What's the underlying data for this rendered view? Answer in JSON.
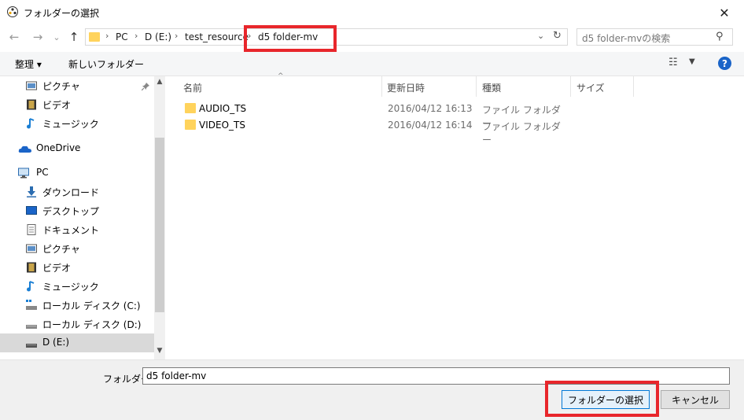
{
  "window": {
    "title": "フォルダーの選択",
    "close_glyph": "✕"
  },
  "nav": {
    "back_glyph": "←",
    "forward_glyph": "→",
    "recent_glyph": "⌄",
    "up_glyph": "↑",
    "breadcrumbs": [
      "PC",
      "D (E:)",
      "test_resource",
      "d5 folder-mv"
    ],
    "sep_glyph": "›",
    "chevron_glyph": "⌄",
    "refresh_glyph": "↻",
    "search_placeholder": "d5 folder-mvの検索",
    "search_glyph": "⚲"
  },
  "toolbar": {
    "organize_label": "整理 ▾",
    "new_folder_label": "新しいフォルダー",
    "view_glyph": "☷",
    "view_chevron": "▼",
    "help_glyph": "?"
  },
  "sidebar": {
    "items": [
      {
        "label": "ピクチャ"
      },
      {
        "label": "ビデオ"
      },
      {
        "label": "ミュージック"
      },
      {
        "label": "OneDrive"
      },
      {
        "label": "PC"
      },
      {
        "label": "ダウンロード"
      },
      {
        "label": "デスクトップ"
      },
      {
        "label": "ドキュメント"
      },
      {
        "label": "ピクチャ"
      },
      {
        "label": "ビデオ"
      },
      {
        "label": "ミュージック"
      },
      {
        "label": "ローカル ディスク (C:)"
      },
      {
        "label": "ローカル ディスク (D:)"
      },
      {
        "label": "D (E:)"
      }
    ],
    "pin_glyph": "📌"
  },
  "scrollbar": {
    "up_glyph": "▲",
    "down_glyph": "▼"
  },
  "list": {
    "columns": [
      "名前",
      "更新日時",
      "種類",
      "サイズ"
    ],
    "sort_glyph": "^",
    "rows": [
      {
        "name": "AUDIO_TS",
        "date": "2016/04/12 16:13",
        "type": "ファイル フォルダー"
      },
      {
        "name": "VIDEO_TS",
        "date": "2016/04/12 16:14",
        "type": "ファイル フォルダー"
      }
    ]
  },
  "footer": {
    "folder_label": "フォルダー:",
    "folder_value": "d5 folder-mv",
    "select_label": "フォルダーの選択",
    "cancel_label": "キャンセル"
  },
  "colors": {
    "highlight": "#e8262b",
    "folder": "#ffd35c",
    "accent": "#0078d7"
  }
}
